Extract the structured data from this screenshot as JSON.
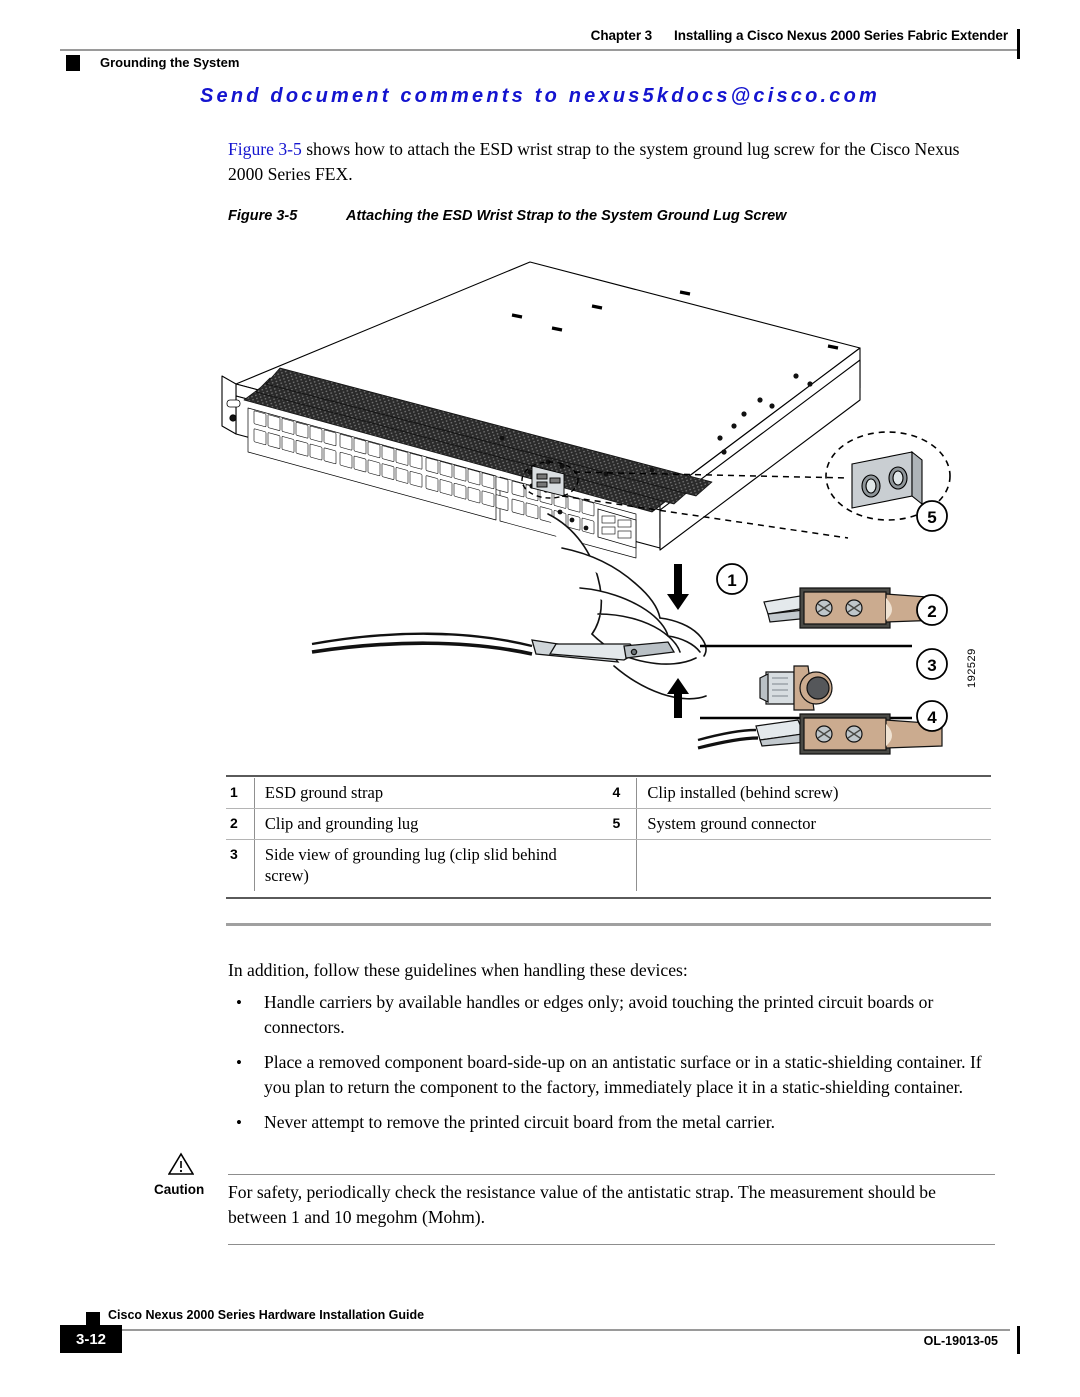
{
  "header": {
    "chapter_label": "Chapter 3",
    "chapter_title": "Installing a Cisco Nexus 2000 Series Fabric Extender",
    "section": "Grounding the System"
  },
  "banner": {
    "text": "Send document comments to nexus5kdocs@cisco.com",
    "color": "#1414cf"
  },
  "body": {
    "intro_xref": "Figure 3-5",
    "intro_rest": " shows how to attach the ESD wrist strap to the system ground lug screw for the Cisco Nexus 2000 Series FEX."
  },
  "figure": {
    "caption_number": "Figure 3-5",
    "caption_title": "Attaching the ESD Wrist Strap to the System Ground Lug Screw",
    "art_id": "192529",
    "callouts": [
      "1",
      "2",
      "3",
      "4",
      "5"
    ]
  },
  "legend": {
    "rows": [
      {
        "n1": "1",
        "t1": "ESD ground strap",
        "n2": "4",
        "t2": "Clip installed (behind screw)"
      },
      {
        "n1": "2",
        "t1": "Clip and grounding lug",
        "n2": "5",
        "t2": "System ground connector"
      },
      {
        "n1": "3",
        "t1": "Side view of grounding lug (clip slid behind screw)",
        "n2": "",
        "t2": ""
      }
    ]
  },
  "guidelines": {
    "intro": "In addition, follow these guidelines when handling these devices:",
    "bullet_glyph": "•",
    "items": [
      "Handle carriers by available handles or edges only; avoid touching the printed circuit boards or connectors.",
      "Place a removed component board-side-up on an antistatic surface or in a static-shielding container. If you plan to return the component to the factory, immediately place it in a static-shielding container.",
      "Never attempt to remove the printed circuit board from the metal carrier."
    ]
  },
  "caution": {
    "label": "Caution",
    "text": "For safety, periodically check the resistance value of the antistatic strap. The measurement should be between 1 and 10 megohm (Mohm)."
  },
  "footer": {
    "guide_title": "Cisco Nexus 2000 Series Hardware Installation Guide",
    "page_number": "3-12",
    "doc_id": "OL-19013-05"
  }
}
